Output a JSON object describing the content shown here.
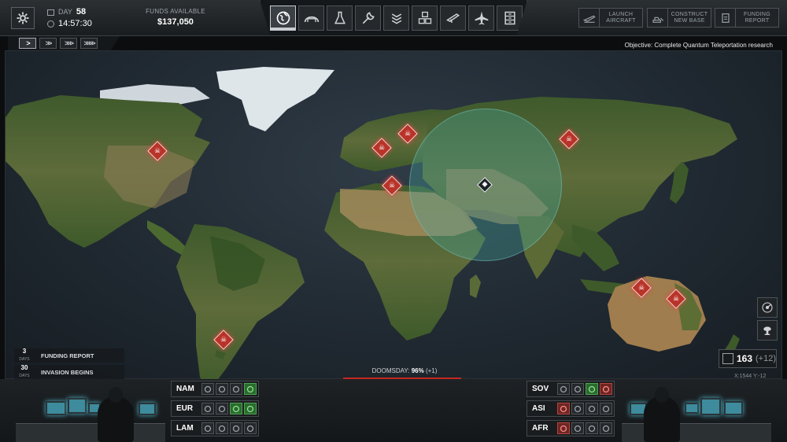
{
  "topbar": {
    "day_label": "DAY",
    "day_value": "58",
    "time": "14:57:30",
    "funds_label": "FUNDS AVAILABLE",
    "funds_value": "$137,050",
    "tabs": [
      {
        "icon": "globe-icon",
        "active": true
      },
      {
        "icon": "hangar-icon",
        "active": false
      },
      {
        "icon": "research-flask-icon",
        "active": false
      },
      {
        "icon": "engineering-wrench-icon",
        "active": false
      },
      {
        "icon": "soldier-rank-icon",
        "active": false
      },
      {
        "icon": "base-facilities-icon",
        "active": false
      },
      {
        "icon": "rifle-icon",
        "active": false
      },
      {
        "icon": "aircraft-icon",
        "active": false
      },
      {
        "icon": "archive-icon",
        "active": false
      }
    ],
    "launch_aircraft": "LAUNCH\nAIRCRAFT",
    "construct_new_base": "CONSTRUCT\nNEW BASE",
    "funding_report": "FUNDING\nREPORT"
  },
  "speed_controls": [
    ">",
    ">>",
    ">>>",
    ">>>>"
  ],
  "objective": "Objective: Complete Quantum Teleportation research",
  "map_markers": [
    {
      "region": "north-america"
    },
    {
      "region": "western-europe"
    },
    {
      "region": "eastern-europe"
    },
    {
      "region": "north-africa"
    },
    {
      "region": "central-asia"
    },
    {
      "region": "south-america"
    },
    {
      "region": "australia-west"
    },
    {
      "region": "australia-east"
    }
  ],
  "events": [
    {
      "days": "3",
      "days_unit": "DAYS",
      "name": "FUNDING REPORT"
    },
    {
      "days": "30",
      "days_unit": "DAYS",
      "name": "INVASION BEGINS"
    }
  ],
  "doomsday": {
    "label": "DOOMSDAY:",
    "value": "96%",
    "delta": "(+1)",
    "progress": 0.96
  },
  "scientists": {
    "value": "163",
    "delta": "(+12)"
  },
  "coords": "X:1544  Y:-12",
  "regions_left": [
    {
      "name": "NAM",
      "states": [
        "neutral",
        "neutral",
        "neutral",
        "green"
      ]
    },
    {
      "name": "EUR",
      "states": [
        "neutral",
        "neutral",
        "green",
        "green"
      ]
    },
    {
      "name": "LAM",
      "states": [
        "neutral",
        "neutral",
        "neutral",
        "neutral"
      ]
    }
  ],
  "regions_right": [
    {
      "name": "SOV",
      "states": [
        "neutral",
        "neutral",
        "green",
        "red"
      ]
    },
    {
      "name": "ASI",
      "states": [
        "red",
        "neutral",
        "neutral",
        "neutral"
      ]
    },
    {
      "name": "AFR",
      "states": [
        "red",
        "neutral",
        "neutral",
        "neutral"
      ]
    }
  ],
  "colors": {
    "accent_red": "#c4271f",
    "radar": "#46aaa0",
    "active_green": "#2a6b2e"
  }
}
